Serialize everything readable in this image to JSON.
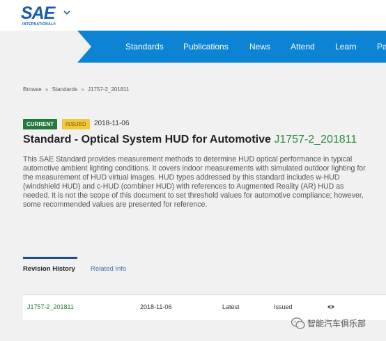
{
  "brand": {
    "logo_text": "SAE",
    "logo_subtext": "INTERNATIONAL®",
    "accent_color": "#0d83d4"
  },
  "nav": {
    "items": [
      "Standards",
      "Publications",
      "News",
      "Attend",
      "Learn",
      "Pa"
    ]
  },
  "breadcrumb": {
    "items": [
      "Browse",
      "Standards",
      "J1757-2_201811"
    ],
    "separator": "»"
  },
  "document": {
    "badge_current": "CURRENT",
    "badge_issued": "ISSUED",
    "date": "2018-11-06",
    "title": "Standard - Optical System HUD for Automotive",
    "code": "J1757-2_201811",
    "description": "This SAE Standard provides measurement methods to determine HUD optical performance in typical automotive ambient lighting conditions. It covers indoor measurements with simulated outdoor lighting for the measurement of HUD virtual images. HUD types addressed by this standard includes w-HUD (windshield HUD) and c-HUD (combiner HUD) with references to Augmented Reality (AR) HUD as needed. It is not the scope of this document to set threshold values for automotive compliance; however, some recommended values are presented for reference."
  },
  "tabs": {
    "items": [
      "Revision History",
      "Related Info"
    ]
  },
  "revisions": [
    {
      "code": "J1757-2_201811",
      "date": "2018-11-06",
      "latest": "Latest",
      "status": "Issued",
      "icon": "eye-icon"
    }
  ],
  "watermark": {
    "text": "智能汽车俱乐部"
  }
}
